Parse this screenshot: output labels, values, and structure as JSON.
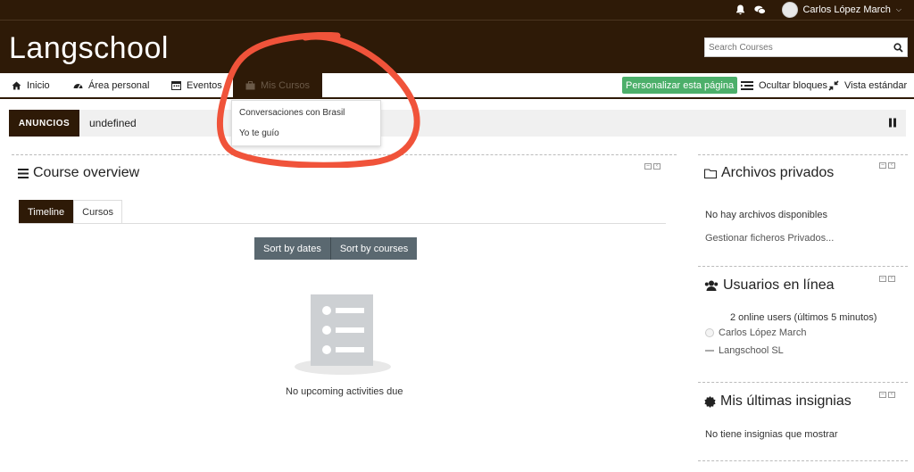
{
  "topbar": {
    "bell_icon": "bell-icon",
    "chat_icon": "chat-icon",
    "user_name": "Carlos López March"
  },
  "header": {
    "brand": "Langschool",
    "search_placeholder": "Search Courses"
  },
  "nav": {
    "inicio": "Inicio",
    "area_personal": "Área personal",
    "eventos": "Eventos",
    "mis_cursos": "Mis Cursos",
    "personalizar": "Personalizar esta página",
    "ocultar_bloques": "Ocultar bloques",
    "vista_estandar": "Vista estándar"
  },
  "dropdown": {
    "items": [
      "Conversaciones con Brasil",
      "Yo te guío"
    ]
  },
  "announcements": {
    "label": "ANUNCIOS",
    "text": "undefined"
  },
  "course_overview": {
    "title": "Course overview",
    "tabs": [
      "Timeline",
      "Cursos"
    ],
    "sort_by_dates": "Sort by dates",
    "sort_by_courses": "Sort by courses",
    "empty_message": "No upcoming activities due"
  },
  "archivos": {
    "title": "Archivos privados",
    "empty": "No hay archivos disponibles",
    "manage_link": "Gestionar ficheros Privados..."
  },
  "usuarios": {
    "title": "Usuarios en línea",
    "summary": "2 online users (últimos 5 minutos)",
    "users": [
      "Carlos López March",
      "Langschool SL"
    ]
  },
  "insignias": {
    "title": "Mis últimas insignias",
    "empty": "No tiene insignias que mostrar"
  },
  "colors": {
    "brand_dark": "#2e1a07",
    "green": "#4caf6a",
    "button_gray": "#5a6870",
    "annotation_red": "#f0533a"
  }
}
